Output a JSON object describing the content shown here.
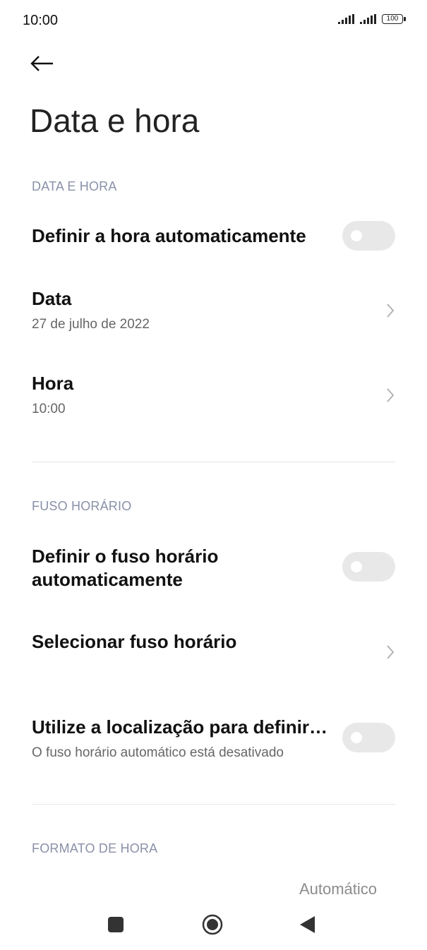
{
  "status_bar": {
    "time": "10:00",
    "battery": "100"
  },
  "page": {
    "title": "Data e hora"
  },
  "sections": {
    "date_time": "DATA E HORA",
    "time_zone": "FUSO HORÁRIO",
    "time_format": "FORMATO DE HORA"
  },
  "items": {
    "auto_time": {
      "label": "Definir a hora automaticamente",
      "enabled": false
    },
    "date": {
      "label": "Data",
      "value": "27 de julho de 2022"
    },
    "time": {
      "label": "Hora",
      "value": "10:00"
    },
    "auto_tz": {
      "label_line1": "Definir o fuso horário",
      "label_line2": "automaticamente",
      "enabled": false
    },
    "select_tz": {
      "label": "Selecionar fuso horário"
    },
    "location_tz": {
      "label": "Utilize a localização para definir…",
      "sub": "O fuso horário automático está desativado",
      "enabled": false
    },
    "time_format": {
      "value": "Automático"
    }
  },
  "icons": {
    "back": "arrow-left-icon",
    "chevron": "chevron-right-icon",
    "recents": "square-icon",
    "home": "circle-icon",
    "nav_back": "triangle-left-icon"
  }
}
